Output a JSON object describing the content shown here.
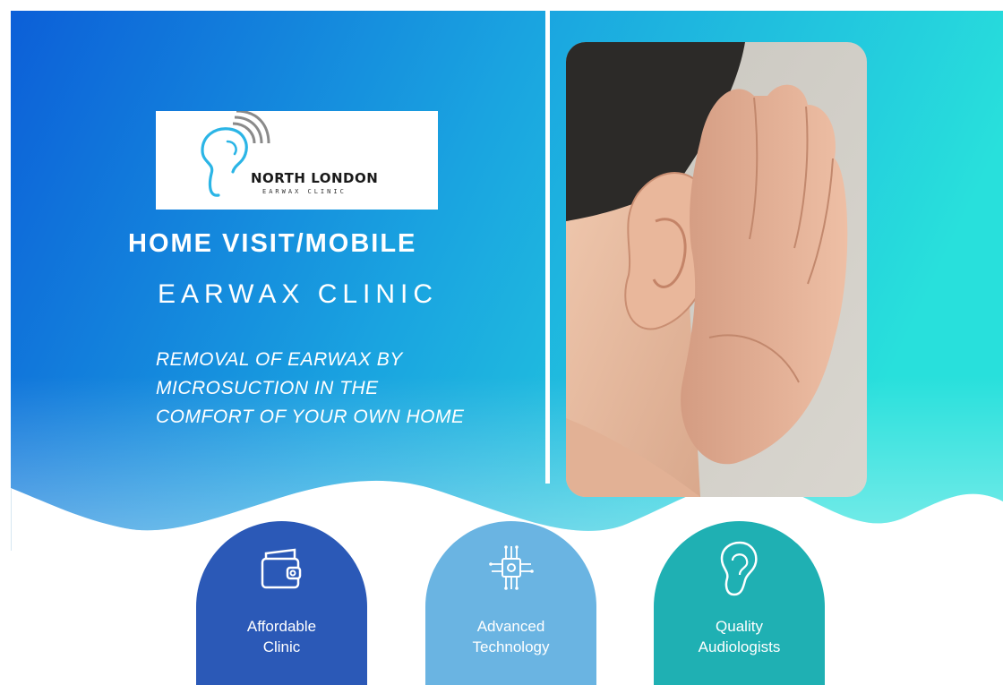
{
  "brand": {
    "name": "NORTH LONDON",
    "subtitle": "EARWAX CLINIC"
  },
  "hero": {
    "headline": "HOME VISIT/MOBILE",
    "subheadline": "EARWAX CLINIC",
    "tagline": "REMOVAL OF EARWAX BY MICROSUCTION IN THE COMFORT OF YOUR OWN HOME"
  },
  "colors": {
    "gradient_start": "#0c5fd8",
    "gradient_mid": "#1aa4e0",
    "gradient_end": "#28e0dc",
    "feature_affordable": "#2b59b7",
    "feature_technology": "#6ab4e2",
    "feature_audiologists": "#1fb0b3"
  },
  "features": [
    {
      "label": "Affordable\nClinic",
      "icon": "wallet-icon"
    },
    {
      "label": "Advanced\nTechnology",
      "icon": "chip-icon"
    },
    {
      "label": "Quality\nAudiologists",
      "icon": "ear-icon"
    }
  ],
  "photo": {
    "subject": "hand-cupped-to-ear"
  }
}
